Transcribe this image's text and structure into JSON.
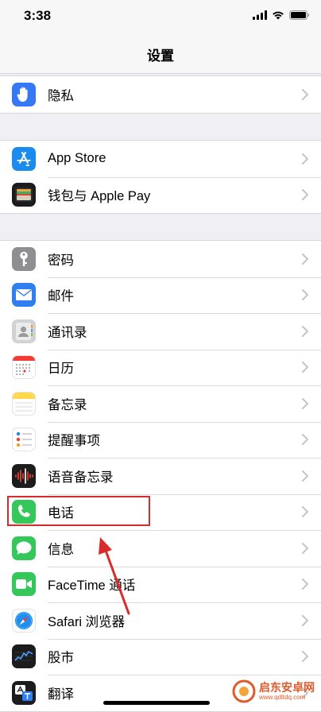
{
  "status": {
    "time": "3:38"
  },
  "nav": {
    "title": "设置"
  },
  "groups": [
    {
      "items": [
        {
          "label": "隐私",
          "icon": "privacy-hand-icon",
          "color": "#3478f6"
        }
      ]
    },
    {
      "items": [
        {
          "label": "App Store",
          "icon": "app-store-icon",
          "color": "#1a8cf0"
        },
        {
          "label": "钱包与 Apple Pay",
          "icon": "wallet-icon",
          "color": "#1c1c1e"
        }
      ]
    },
    {
      "items": [
        {
          "label": "密码",
          "icon": "key-icon",
          "color": "#8e8e93"
        },
        {
          "label": "邮件",
          "icon": "mail-icon",
          "color": "#2f7ff0"
        },
        {
          "label": "通讯录",
          "icon": "contacts-icon",
          "color": "#c7c7cc"
        },
        {
          "label": "日历",
          "icon": "calendar-icon",
          "color": "#ffffff"
        },
        {
          "label": "备忘录",
          "icon": "notes-icon",
          "color": "#ffd84d"
        },
        {
          "label": "提醒事项",
          "icon": "reminders-icon",
          "color": "#ffffff"
        },
        {
          "label": "语音备忘录",
          "icon": "voice-memos-icon",
          "color": "#1c1c1e"
        },
        {
          "label": "电话",
          "icon": "phone-icon",
          "color": "#34c759"
        },
        {
          "label": "信息",
          "icon": "messages-icon",
          "color": "#34c759"
        },
        {
          "label": "FaceTime 通话",
          "icon": "facetime-icon",
          "color": "#34c759"
        },
        {
          "label": "Safari 浏览器",
          "icon": "safari-icon",
          "color": "#ffffff"
        },
        {
          "label": "股市",
          "icon": "stocks-icon",
          "color": "#1c1c1e"
        },
        {
          "label": "翻译",
          "icon": "translate-icon",
          "color": "#1c1c1e"
        }
      ]
    }
  ],
  "watermark": {
    "text": "启东安卓网",
    "url": "www.qdltdq.com"
  },
  "colors": {
    "highlight": "#d92b2b",
    "chevron": "#c4c4c9"
  }
}
